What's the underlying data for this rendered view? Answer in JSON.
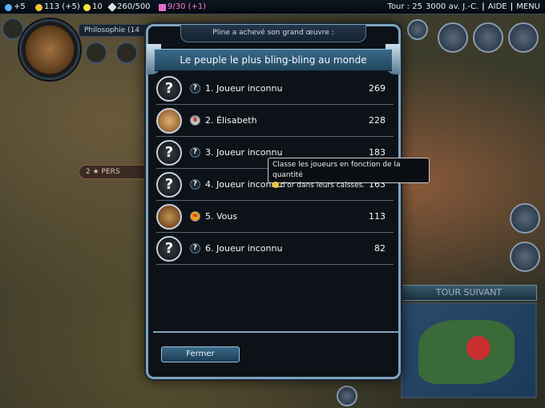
{
  "topbar": {
    "science": "+5",
    "gold": "113 (+5)",
    "happiness": "10",
    "faith": "260/500",
    "culture": "9/30 (+1)",
    "turn": "Tour : 25",
    "date": "3000 av. J.-C.",
    "help": "AIDE",
    "menu": "MENU"
  },
  "hud": {
    "research_label": "Philosophie (14",
    "persia_chip": "2 ★ PERS",
    "next_turn": "TOUR SUIVANT"
  },
  "modal": {
    "caption": "Pline a achevé son grand œuvre :",
    "title": "Le peuple le plus bling-bling au monde",
    "rows": [
      {
        "icon": "?",
        "name": "1. Joueur inconnu",
        "score": "269",
        "portrait": "unknown-portrait-icon"
      },
      {
        "icon": "♛",
        "name": "2. Élisabeth",
        "score": "228",
        "portrait": "elizabeth-portrait"
      },
      {
        "icon": "?",
        "name": "3. Joueur inconnu",
        "score": "183",
        "portrait": "unknown-portrait-icon"
      },
      {
        "icon": "?",
        "name": "4. Joueur inconnu",
        "score": "163",
        "portrait": "unknown-portrait-icon"
      },
      {
        "icon": "≈",
        "name": "5. Vous",
        "score": "113",
        "portrait": "player-portrait"
      },
      {
        "icon": "?",
        "name": "6. Joueur inconnu",
        "score": "82",
        "portrait": "unknown-portrait-icon"
      }
    ],
    "close_label": "Fermer"
  },
  "tooltip": {
    "line1": "Classe les joueurs en fonction de la quantité",
    "line2": "d'or dans leurs caisses."
  },
  "colors": {
    "accent": "#7fa3bd",
    "title_bg": "#3a6a8c",
    "gold": "#f2c43a"
  }
}
